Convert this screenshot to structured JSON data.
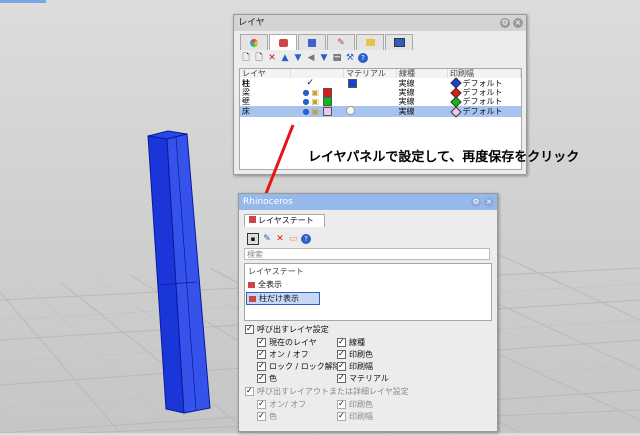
{
  "layer_panel": {
    "title": "レイヤ",
    "columns": [
      "レイヤ",
      "",
      "マテリアル",
      "線種",
      "印刷幅"
    ],
    "rows": [
      {
        "name": "柱",
        "current": "✓",
        "color": "#1a3fd6",
        "linetype": "実線",
        "printwidth": "デフォルト",
        "pw_color": "#1a3fd6",
        "selected": false,
        "first": true
      },
      {
        "name": "梁",
        "current": "",
        "color": "#e01a1a",
        "linetype": "実線",
        "printwidth": "デフォルト",
        "pw_color": "#e01a1a",
        "selected": false
      },
      {
        "name": "壁",
        "current": "",
        "color": "#14b814",
        "linetype": "実線",
        "printwidth": "デフォルト",
        "pw_color": "#14b814",
        "selected": false
      },
      {
        "name": "床",
        "current": "",
        "color": "#f2c8e0",
        "linetype": "実線",
        "printwidth": "デフォルト",
        "pw_color": "#f2c8e0",
        "selected": true
      }
    ]
  },
  "callout": {
    "text": "レイヤパネルで設定して、再度保存をクリック"
  },
  "rhino_panel": {
    "title": "Rhinoceros",
    "tab_label": "レイヤステート",
    "search_placeholder": "検索",
    "list_header": "レイヤステート",
    "states": [
      {
        "label": "全表示",
        "selected": false
      },
      {
        "label": "柱だけ表示",
        "selected": true
      }
    ],
    "restore_group": {
      "label": "呼び出すレイヤ設定",
      "checked": true,
      "options": [
        {
          "label": "現在のレイヤ",
          "checked": true
        },
        {
          "label": "線種",
          "checked": true
        },
        {
          "label": "オン / オフ",
          "checked": true
        },
        {
          "label": "印刷色",
          "checked": true
        },
        {
          "label": "ロック / ロック解除",
          "checked": true
        },
        {
          "label": "印刷幅",
          "checked": true
        },
        {
          "label": "色",
          "checked": true
        },
        {
          "label": "マテリアル",
          "checked": true
        }
      ]
    },
    "layout_group": {
      "label": "呼び出すレイアウトまたは詳細レイヤ設定",
      "checked": true,
      "options": [
        {
          "label": "オン/ オフ",
          "checked": true
        },
        {
          "label": "印刷色",
          "checked": true
        },
        {
          "label": "色",
          "checked": true
        },
        {
          "label": "印刷幅",
          "checked": true
        }
      ]
    }
  },
  "colors": {
    "column": "#1f3fd8",
    "arrow": "#e81414",
    "accent": "#97b8ea"
  }
}
